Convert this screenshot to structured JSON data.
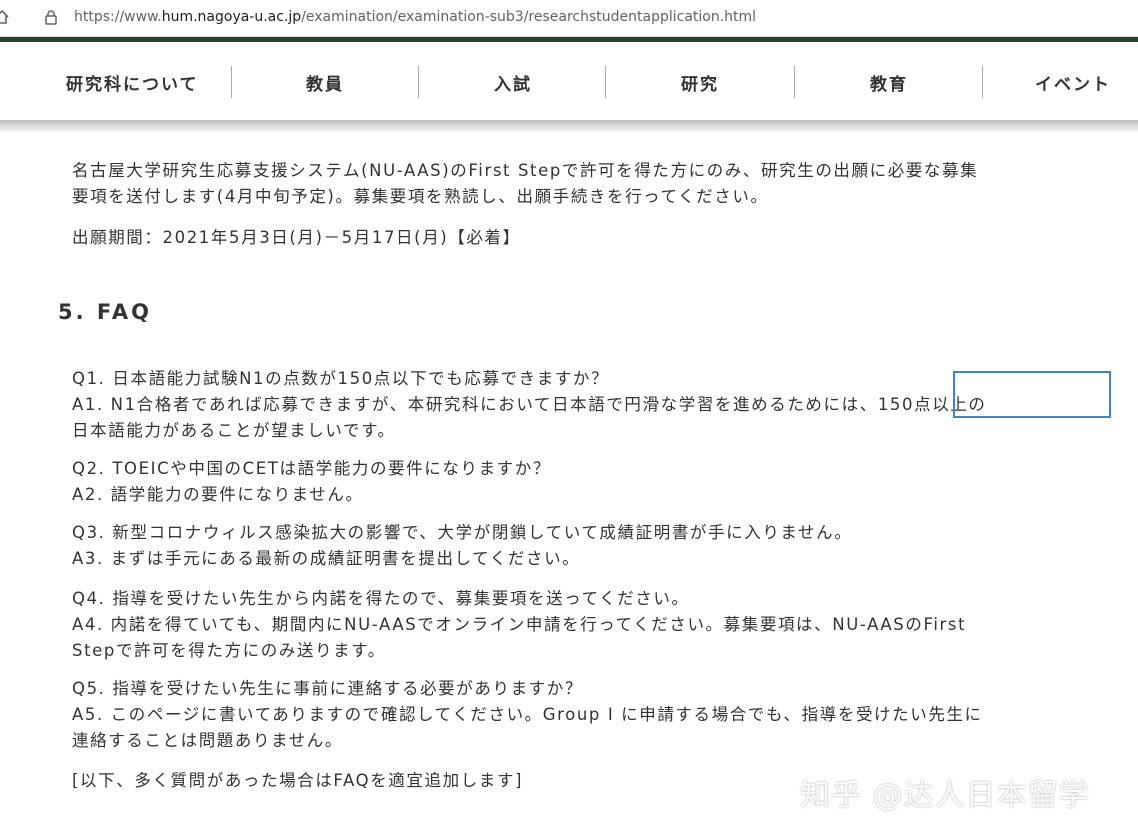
{
  "browser": {
    "url_scheme": "https://www.",
    "url_host": "hum.nagoya-u.ac.jp",
    "url_path": "/examination/examination-sub3/researchstudentapplication.html"
  },
  "nav": {
    "items": [
      {
        "label": "研究科について"
      },
      {
        "label": "教員"
      },
      {
        "label": "入試"
      },
      {
        "label": "研究"
      },
      {
        "label": "教育"
      },
      {
        "label": "イベント"
      }
    ]
  },
  "intro": {
    "line1": "名古屋大学研究生応募支援システム(NU-AAS)のFirst Stepで許可を得た方にのみ、研究生の出願に必要な募集",
    "line2": "要項を送付します(4月中旬予定)。募集要項を熟読し、出願手続きを行ってください。",
    "period": "出願期間：2021年5月3日(月)－5月17日(月)【必着】"
  },
  "faq": {
    "title": "5. FAQ",
    "items": [
      {
        "lines": [
          "Q1. 日本語能力試験N1の点数が150点以下でも応募できますか？",
          "A1. N1合格者であれば応募できますが、本研究科において日本語で円滑な学習を進めるためには、150点以上の",
          "日本語能力があることが望ましいです。"
        ]
      },
      {
        "lines": [
          "Q2. TOEICや中国のCETは語学能力の要件になりますか？",
          "A2. 語学能力の要件になりません。"
        ]
      },
      {
        "lines": [
          "Q3. 新型コロナウィルス感染拡大の影響で、大学が閉鎖していて成績証明書が手に入りません。",
          "A3. まずは手元にある最新の成績証明書を提出してください。"
        ]
      },
      {
        "lines": [
          "Q4. 指導を受けたい先生から内諾を得たので、募集要項を送ってください。",
          "A4. 内諾を得ていても、期間内にNU-AASでオンライン申請を行ってください。募集要項は、NU-AASのFirst",
          "Stepで許可を得た方にのみ送ります。"
        ]
      },
      {
        "lines": [
          "Q5. 指導を受けたい先生に事前に連絡する必要がありますか？",
          "A5. このページに書いてありますので確認してください。Group I に申請する場合でも、指導を受けたい先生に",
          "連絡することは問題ありません。"
        ]
      }
    ],
    "footnote": "[以下、多く質問があった場合はFAQを適宜追加します]"
  },
  "watermark": "知乎 @达人日本留学",
  "colors": {
    "header_bar": "#24422e",
    "highlight": "#3d85c6",
    "text": "#333333"
  }
}
